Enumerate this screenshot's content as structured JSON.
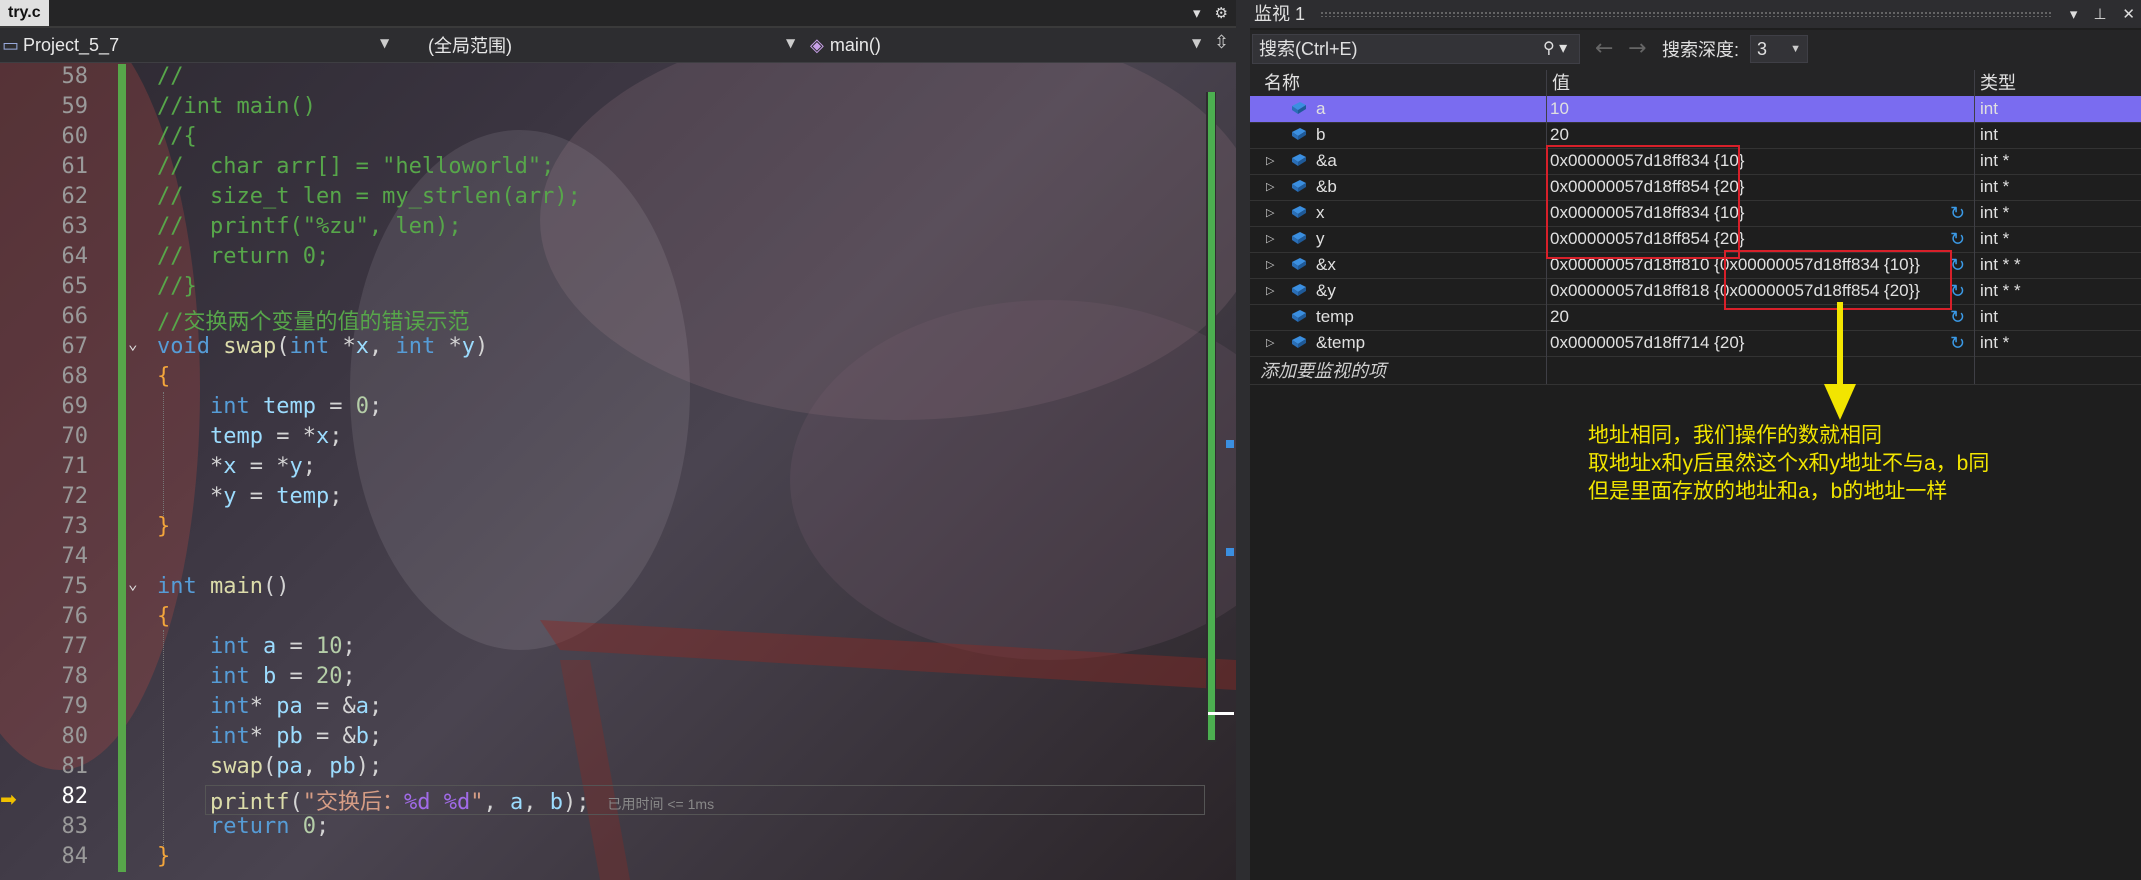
{
  "editor": {
    "tab_label": "try.c",
    "nav_project": "Project_5_7",
    "nav_scope": "(全局范围)",
    "nav_function": "main()",
    "time_hint": "已用时间 <= 1ms",
    "lines": [
      {
        "n": "58",
        "t": "//"
      },
      {
        "n": "59",
        "t": "//int main()"
      },
      {
        "n": "60",
        "t": "//{"
      },
      {
        "n": "61",
        "t": "//  char arr[] = \"helloworld\";"
      },
      {
        "n": "62",
        "t": "//  size_t len = my_strlen(arr);"
      },
      {
        "n": "63",
        "t": "//  printf(\"%zu\", len);"
      },
      {
        "n": "64",
        "t": "//  return 0;"
      },
      {
        "n": "65",
        "t": "//}"
      },
      {
        "n": "66",
        "t": "//交换两个变量的值的错误示范"
      },
      {
        "n": "67",
        "t": "void swap(int *x, int *y)"
      },
      {
        "n": "68",
        "t": "{"
      },
      {
        "n": "69",
        "t": "    int temp = 0;"
      },
      {
        "n": "70",
        "t": "    temp = *x;"
      },
      {
        "n": "71",
        "t": "    *x = *y;"
      },
      {
        "n": "72",
        "t": "    *y = temp;"
      },
      {
        "n": "73",
        "t": "}"
      },
      {
        "n": "74",
        "t": ""
      },
      {
        "n": "75",
        "t": "int main()"
      },
      {
        "n": "76",
        "t": "{"
      },
      {
        "n": "77",
        "t": "    int a = 10;"
      },
      {
        "n": "78",
        "t": "    int b = 20;"
      },
      {
        "n": "79",
        "t": "    int* pa = &a;"
      },
      {
        "n": "80",
        "t": "    int* pb = &b;"
      },
      {
        "n": "81",
        "t": "    swap(pa, pb);"
      },
      {
        "n": "82",
        "t": "    printf(\"交换后：%d %d\", a, b);"
      },
      {
        "n": "83",
        "t": "    return 0;"
      },
      {
        "n": "84",
        "t": "}"
      }
    ]
  },
  "watch": {
    "title": "监视 1",
    "search_placeholder": "搜索(Ctrl+E)",
    "depth_label": "搜索深度:",
    "depth_value": "3",
    "col_name": "名称",
    "col_value": "值",
    "col_type": "类型",
    "add_item": "添加要监视的项",
    "rows": [
      {
        "name": "a",
        "value": "10",
        "type": "int",
        "expand": false,
        "refresh": false,
        "selected": true
      },
      {
        "name": "b",
        "value": "20",
        "type": "int",
        "expand": false,
        "refresh": false,
        "selected": false
      },
      {
        "name": "&a",
        "value": "0x00000057d18ff834 {10}",
        "type": "int *",
        "expand": true,
        "refresh": false,
        "selected": false
      },
      {
        "name": "&b",
        "value": "0x00000057d18ff854 {20}",
        "type": "int *",
        "expand": true,
        "refresh": false,
        "selected": false
      },
      {
        "name": "x",
        "value": "0x00000057d18ff834 {10}",
        "type": "int *",
        "expand": true,
        "refresh": true,
        "selected": false
      },
      {
        "name": "y",
        "value": "0x00000057d18ff854 {20}",
        "type": "int *",
        "expand": true,
        "refresh": true,
        "selected": false
      },
      {
        "name": "&x",
        "value": "0x00000057d18ff810 {0x00000057d18ff834 {10}}",
        "type": "int * *",
        "expand": true,
        "refresh": true,
        "selected": false
      },
      {
        "name": "&y",
        "value": "0x00000057d18ff818 {0x00000057d18ff854 {20}}",
        "type": "int * *",
        "expand": true,
        "refresh": true,
        "selected": false
      },
      {
        "name": "temp",
        "value": "20",
        "type": "int",
        "expand": false,
        "refresh": true,
        "selected": false
      },
      {
        "name": "&temp",
        "value": "0x00000057d18ff714 {20}",
        "type": "int *",
        "expand": true,
        "refresh": true,
        "selected": false
      }
    ]
  },
  "annotation": {
    "line1": "地址相同，我们操作的数就相同",
    "line2": "取地址x和y后虽然这个x和y地址不与a，b同",
    "line3": "但是里面存放的地址和a，b的地址一样",
    "arrow_color": "#f2e500",
    "box_color": "#d8202a"
  }
}
